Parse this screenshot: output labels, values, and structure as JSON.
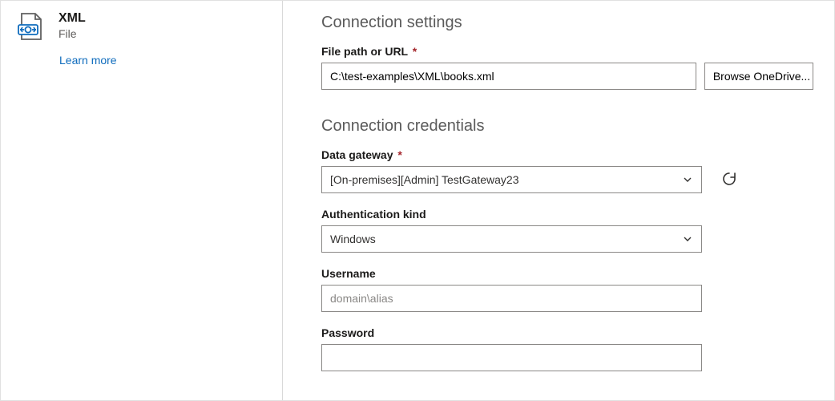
{
  "sidebar": {
    "connector_title": "XML",
    "connector_subtitle": "File",
    "learn_more": "Learn more"
  },
  "settings": {
    "heading": "Connection settings",
    "filepath_label": "File path or URL",
    "filepath_value": "C:\\test-examples\\XML\\books.xml",
    "browse_label": "Browse OneDrive..."
  },
  "credentials": {
    "heading": "Connection credentials",
    "gateway_label": "Data gateway",
    "gateway_value": "[On-premises][Admin] TestGateway23",
    "auth_label": "Authentication kind",
    "auth_value": "Windows",
    "username_label": "Username",
    "username_placeholder": "domain\\alias",
    "username_value": "",
    "password_label": "Password",
    "password_value": ""
  },
  "required_marker": "*"
}
